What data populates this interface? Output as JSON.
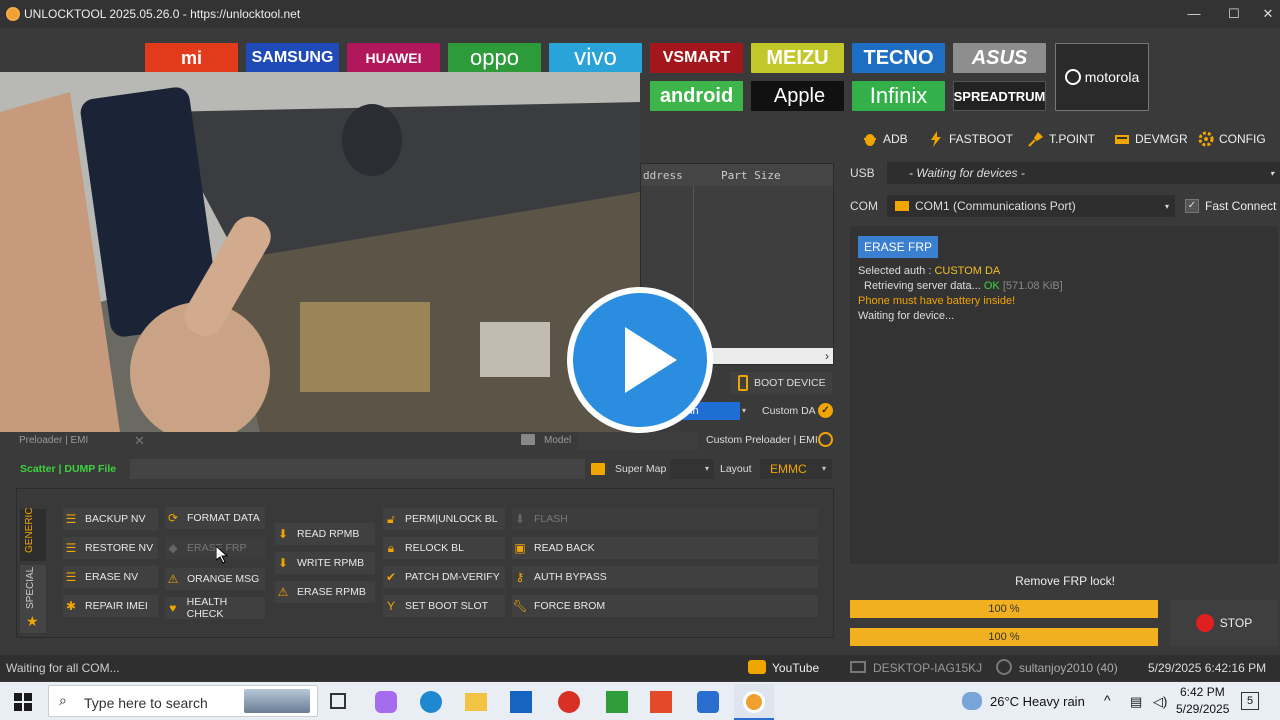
{
  "window": {
    "title": "UNLOCKTOOL 2025.05.26.0 - https://unlocktool.net",
    "buttons": {
      "minimize": "—",
      "maximize": "☐",
      "close": "✕"
    }
  },
  "brands_row1": [
    "mi",
    "SAMSUNG",
    "HUAWEI",
    "oppo",
    "vivo",
    "VSMART",
    "MEIZU",
    "TECNO",
    "ASUS"
  ],
  "brands_row2": [
    "android",
    "Apple",
    "Infinix",
    "SPREADTRUM"
  ],
  "brand_motorola": "motorola",
  "toolbar": {
    "adb": "ADB",
    "fastboot": "FASTBOOT",
    "tpoint": "T.POINT",
    "devmgr": "DEVMGR",
    "config": "CONFIG"
  },
  "partitions": {
    "col_address": "ddress",
    "col_size": "Part Size"
  },
  "left": {
    "boot_device": "BOOT DEVICE",
    "custom_da": "Custom DA",
    "custom_preloader": "Custom Preloader | EMI",
    "preloader_label": "Preloader | EMI",
    "model_label": "Model",
    "scatter_label": "Scatter | DUMP File",
    "super_map": "Super Map",
    "layout_label": "Layout",
    "layout_value": "EMMC",
    "partial_select": "ein"
  },
  "tabs": {
    "generic": "GENERIC",
    "special": "SPECIAL"
  },
  "functions": {
    "col1": [
      "BACKUP NV",
      "RESTORE NV",
      "ERASE NV",
      "REPAIR IMEI"
    ],
    "col2": [
      "FORMAT DATA",
      "ERASE FRP",
      "ORANGE MSG",
      "HEALTH CHECK"
    ],
    "col3": [
      "READ RPMB",
      "WRITE RPMB",
      "ERASE RPMB"
    ],
    "col4": [
      "PERM|UNLOCK BL",
      "RELOCK BL",
      "PATCH DM-VERIFY",
      "SET BOOT SLOT"
    ],
    "col5": [
      "FLASH",
      "READ BACK",
      "AUTH BYPASS",
      "FORCE BROM"
    ]
  },
  "right": {
    "usb_label": "USB",
    "usb_value": "- Waiting for devices -",
    "com_label": "COM",
    "com_value": "COM1 (Communications Port)",
    "fast_connect": "Fast Connect",
    "operation": "ERASE FRP",
    "log": {
      "auth_prefix": "Selected auth : ",
      "auth_value": "CUSTOM DA",
      "retrieving": "Retrieving server data... ",
      "ok": "OK",
      "size": "[571.08 KiB]",
      "battery": "Phone must have battery inside!",
      "waiting": "Waiting for device..."
    },
    "status_title": "Remove FRP lock!",
    "progress1": "100 %",
    "progress2": "100 %",
    "stop": "STOP"
  },
  "statusbar": {
    "left": "Waiting for all COM...",
    "youtube": "YouTube",
    "pc": "DESKTOP-IAG15KJ",
    "user": "sultanjoy2010 (40)",
    "datetime": "5/29/2025 6:42:16 PM"
  },
  "taskbar": {
    "search_placeholder": "Type here to search",
    "weather": "26°C  Heavy rain",
    "time": "6:42 PM",
    "date": "5/29/2025",
    "notif_count": "5"
  },
  "colors": {
    "accent_orange": "#f0a500",
    "progress": "#f0b020",
    "operation_blue": "#3b7fd0",
    "scatter_green": "#3fd23f"
  }
}
